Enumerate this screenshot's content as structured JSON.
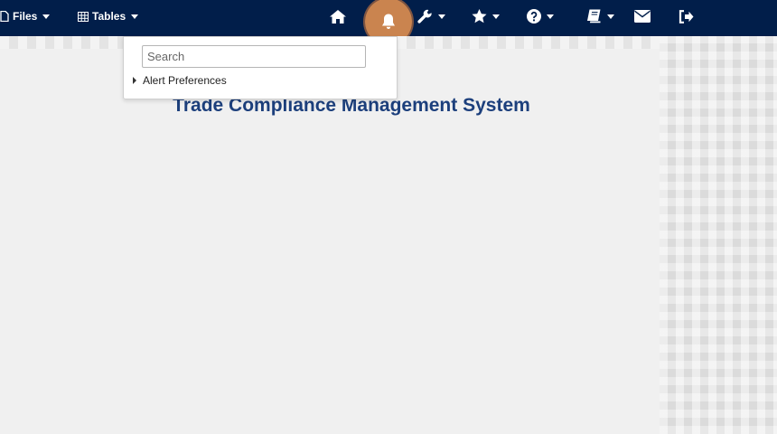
{
  "navbar": {
    "files_label": "Files",
    "tables_label": "Tables",
    "icons": [
      "file-icon",
      "table-icon",
      "home-icon",
      "bell-icon",
      "wrench-icon",
      "star-icon",
      "question-icon",
      "book-icon",
      "envelope-icon",
      "sign-out-icon"
    ]
  },
  "alerts_dropdown": {
    "search_placeholder": "Search",
    "items": [
      {
        "label": "Alert Preferences"
      }
    ]
  },
  "main": {
    "title": "Trade Compliance Management System"
  },
  "colors": {
    "navbar": "#011e4a",
    "title": "#1c3f7c",
    "highlight": "#ed9650"
  }
}
